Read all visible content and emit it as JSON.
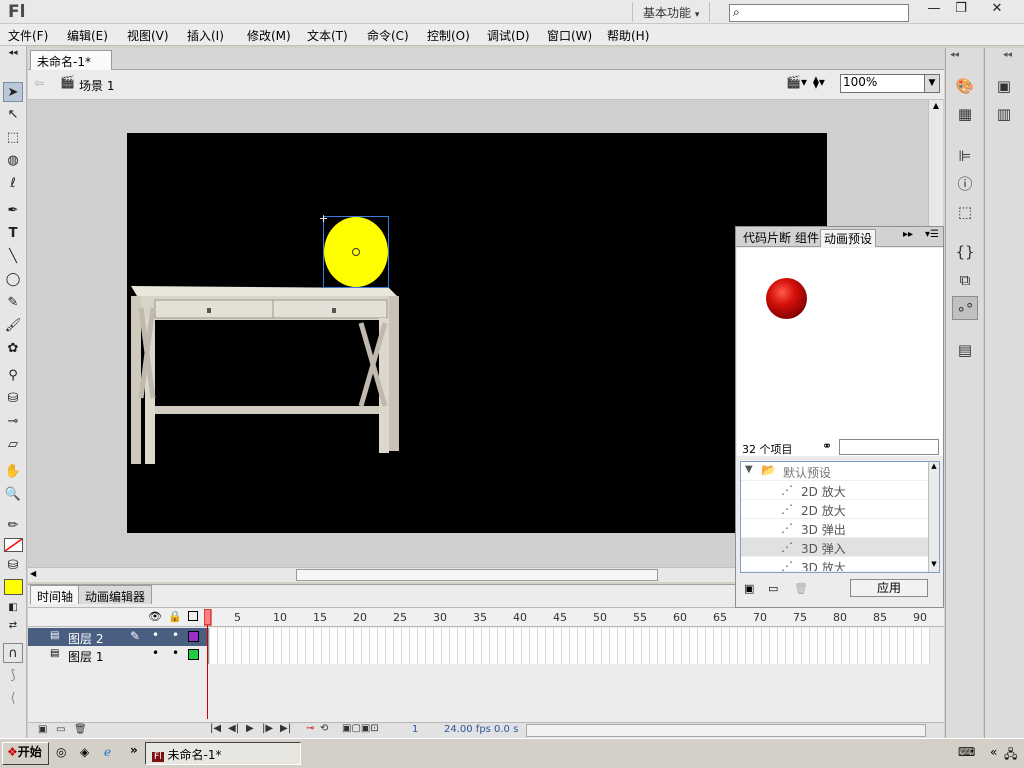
{
  "app": {
    "logo": "Fl",
    "workspace": "基本功能",
    "search_placeholder": ""
  },
  "window_controls": {
    "minimize": "—",
    "restore": "❐",
    "close": "✕"
  },
  "menu": [
    "文件(F)",
    "编辑(E)",
    "视图(V)",
    "插入(I)",
    "修改(M)",
    "文本(T)",
    "命令(C)",
    "控制(O)",
    "调试(D)",
    "窗口(W)",
    "帮助(H)"
  ],
  "document": {
    "tab_title": "未命名-1*",
    "tab_close": "×",
    "scene": "场景 1",
    "zoom": "100%"
  },
  "timeline": {
    "tabs": [
      "时间轴",
      "动画编辑器"
    ],
    "frame_numbers": [
      "1",
      "5",
      "10",
      "15",
      "20",
      "25",
      "30",
      "35",
      "40",
      "45",
      "50",
      "55",
      "60",
      "65",
      "70",
      "75",
      "80",
      "85",
      "90"
    ],
    "layers": [
      {
        "name": "图层 2",
        "color": "#9b30c8",
        "selected": true
      },
      {
        "name": "图层 1",
        "color": "#22cc44",
        "selected": false
      }
    ],
    "current_frame": "1",
    "fps": "24.00 fps",
    "time": "0.0 s"
  },
  "motion_presets": {
    "tabs": [
      "代码片断",
      "组件",
      "动画预设"
    ],
    "item_count": "32 个项目",
    "folder": "默认预设",
    "items": [
      "2D 放大",
      "2D 放大",
      "3D 弹出",
      "3D 弹入",
      "3D 放大"
    ],
    "highlighted_index": 3,
    "apply_label": "应用"
  },
  "taskbar": {
    "start": "开始",
    "task": "未命名-1*"
  },
  "colors": {
    "stroke": "#ff0000",
    "fill": "#ffff00",
    "stage": "#000000"
  }
}
